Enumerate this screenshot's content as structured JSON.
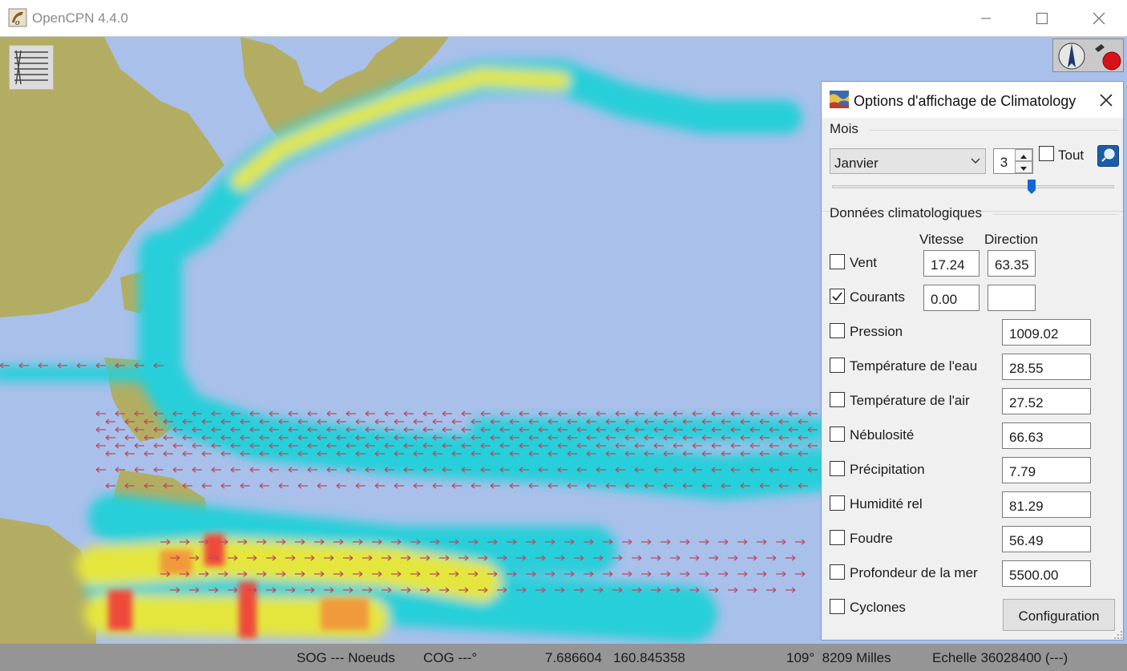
{
  "window": {
    "title": "OpenCPN 4.4.0",
    "controls": [
      "minimize",
      "maximize",
      "close"
    ]
  },
  "toolbar": {
    "menu_icon": "hamburger-tools-icon",
    "compass_icon": "north-arrow-icon",
    "record_icon": "record-red-icon"
  },
  "dialog": {
    "title": "Options d'affichage de Climatology",
    "month_group_label": "Mois",
    "month_select": {
      "value": "Janvier",
      "options_visible": [
        "Janvier"
      ]
    },
    "month_spin_value": "3",
    "all_label": "Tout",
    "all_checked": false,
    "slider": {
      "position_fraction": 0.72
    },
    "data_group_label": "Données climatologiques",
    "col_speed": "Vitesse",
    "col_direction": "Direction",
    "rows": [
      {
        "label": "Vent",
        "checked": false,
        "speed": "17.24",
        "direction": "63.35"
      },
      {
        "label": "Courants",
        "checked": true,
        "speed": "0.00",
        "direction": ""
      },
      {
        "label": "Pression",
        "checked": false,
        "value": "1009.02"
      },
      {
        "label": "Température de l'eau",
        "checked": false,
        "value": "28.55"
      },
      {
        "label": "Température de l'air",
        "checked": false,
        "value": "27.52"
      },
      {
        "label": "Nébulosité",
        "checked": false,
        "value": "66.63"
      },
      {
        "label": "Précipitation",
        "checked": false,
        "value": "7.79"
      },
      {
        "label": "Humidité rel",
        "checked": false,
        "value": "81.29"
      },
      {
        "label": "Foudre",
        "checked": false,
        "value": "56.49"
      },
      {
        "label": "Profondeur de la mer",
        "checked": false,
        "value": "5500.00"
      },
      {
        "label": "Cyclones",
        "checked": false
      }
    ],
    "config_button": "Configuration"
  },
  "statusbar": {
    "sog": "SOG --- Noeuds",
    "cog": "COG ---°",
    "position": "7.686604   160.845358",
    "bearing_distance": "109°  8209 Milles",
    "scale": "Echelle 36028400 (---)"
  },
  "colors": {
    "sea": "#a9c0ea",
    "land": "#b2ad63",
    "current_low": "#25cfd9",
    "current_mid": "#e4e63e",
    "current_high": "#ee4a3a",
    "arrow": "#c2475f",
    "checkmark": "#1b1b1b"
  }
}
